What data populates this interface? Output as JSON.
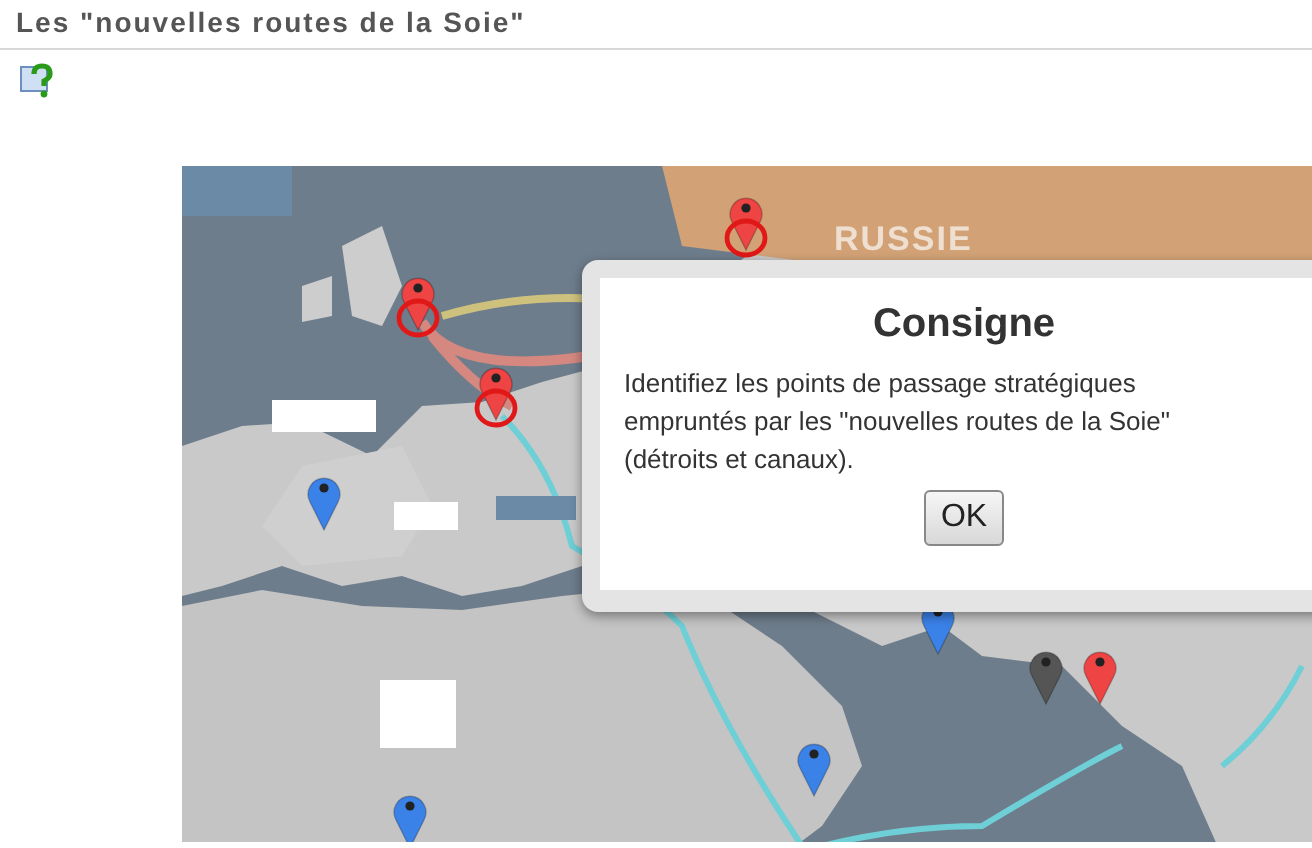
{
  "window": {
    "title": "Les \"nouvelles routes de la Soie\""
  },
  "map": {
    "region_labels": [
      "RUSSIE"
    ],
    "markers": [
      {
        "color": "#ee4444",
        "circled": true
      },
      {
        "color": "#ee4444",
        "circled": true
      },
      {
        "color": "#ee4444",
        "circled": true
      },
      {
        "color": "#3b82e8",
        "circled": false
      },
      {
        "color": "#3b82e8",
        "circled": false
      },
      {
        "color": "#555555",
        "circled": false
      },
      {
        "color": "#ee4444",
        "circled": false
      },
      {
        "color": "#3b82e8",
        "circled": false
      },
      {
        "color": "#3b82e8",
        "circled": false
      }
    ]
  },
  "dialog": {
    "title": "Consigne",
    "message": "Identifiez les points de passage stratégiques empruntés par les \"nouvelles routes de la Soie\" (détroits et canaux).",
    "buttons": [
      "OK"
    ]
  }
}
